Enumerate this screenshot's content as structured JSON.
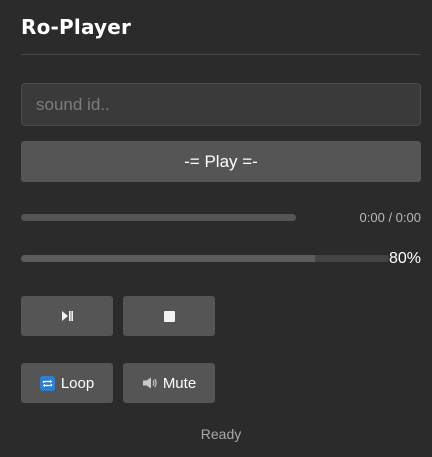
{
  "app": {
    "title": "Ro-Player"
  },
  "sound_input": {
    "placeholder": "sound id..",
    "value": ""
  },
  "play_button": {
    "label": "-= Play =-"
  },
  "seek": {
    "progress": 0,
    "time_text": "0:00 / 0:00"
  },
  "volume": {
    "level": 0.8,
    "text": "80%"
  },
  "controls": {
    "playpause_icon": "play-pause-icon",
    "stop_icon": "stop-icon",
    "loop_label": "Loop",
    "loop_icon": "loop-icon",
    "mute_label": "Mute",
    "mute_icon": "speaker-icon"
  },
  "status": {
    "text": "Ready"
  },
  "colors": {
    "background": "#2b2b2b",
    "button": "#555555",
    "loop_icon_bg": "#2f7fd0"
  }
}
